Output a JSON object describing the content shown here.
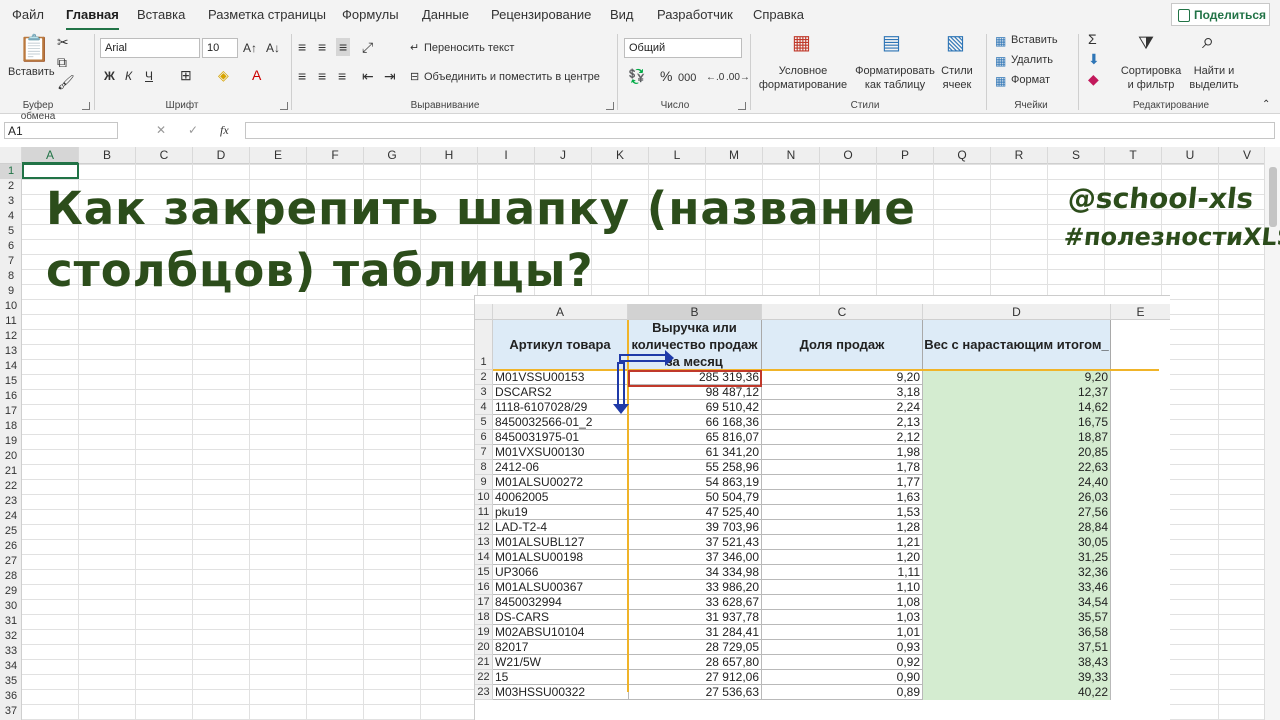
{
  "menu": {
    "tabs": [
      "Файл",
      "Главная",
      "Вставка",
      "Разметка страницы",
      "Формулы",
      "Данные",
      "Рецензирование",
      "Вид",
      "Разработчик",
      "Справка"
    ],
    "active": "Главная",
    "share": "Поделиться"
  },
  "ribbon": {
    "clipboard": {
      "paste": "Вставить",
      "label": "Буфер обмена"
    },
    "font": {
      "name": "Arial",
      "size": "10",
      "label": "Шрифт",
      "bold": "Ж",
      "italic": "К",
      "underline": "Ч"
    },
    "align": {
      "wrap": "Переносить текст",
      "merge": "Объединить и поместить в центре",
      "label": "Выравнивание"
    },
    "number": {
      "format": "Общий",
      "label": "Число"
    },
    "styles": {
      "cond1": "Условное",
      "cond2": "форматирование",
      "fmt1": "Форматировать",
      "fmt2": "как таблицу",
      "cell1": "Стили",
      "cell2": "ячеек",
      "label": "Стили"
    },
    "cells": {
      "insert": "Вставить",
      "delete": "Удалить",
      "format": "Формат",
      "label": "Ячейки"
    },
    "edit": {
      "sort1": "Сортировка",
      "sort2": "и фильтр",
      "find1": "Найти и",
      "find2": "выделить",
      "label": "Редактирование"
    }
  },
  "formula": {
    "namebox": "A1",
    "fx": "fx"
  },
  "columns": [
    "A",
    "B",
    "C",
    "D",
    "E",
    "F",
    "G",
    "H",
    "I",
    "J",
    "K",
    "L",
    "M",
    "N",
    "O",
    "P",
    "Q",
    "R",
    "S",
    "T",
    "U",
    "V"
  ],
  "rows": [
    "1",
    "2",
    "3",
    "4",
    "5",
    "6",
    "7",
    "8",
    "9",
    "10",
    "11",
    "12",
    "13",
    "14",
    "15",
    "16",
    "17",
    "18",
    "19",
    "20",
    "21",
    "22",
    "23",
    "24",
    "25",
    "26",
    "27",
    "28",
    "29",
    "30",
    "31",
    "32",
    "33",
    "34",
    "35",
    "36",
    "37"
  ],
  "overlay": {
    "line1": "Как закрепить шапку (название",
    "line2": "столбцов) таблицы?",
    "brand1": "@school-xls",
    "brand2": "#полезностиXLS"
  },
  "inset": {
    "cols": [
      "A",
      "B",
      "C",
      "D",
      "E"
    ],
    "headers": {
      "a": "Артикул товара",
      "b": "Выручка или количество продаж за месяц",
      "c": "Доля продаж",
      "d": "Вес с нарастающим итогом_"
    },
    "rows": [
      {
        "n": "2",
        "a": "M01VSSU00153",
        "b": "285 319,36",
        "c": "9,20",
        "d": "9,20"
      },
      {
        "n": "3",
        "a": "DSCARS2",
        "b": "98 487,12",
        "c": "3,18",
        "d": "12,37"
      },
      {
        "n": "4",
        "a": "1118-6107028/29",
        "b": "69 510,42",
        "c": "2,24",
        "d": "14,62"
      },
      {
        "n": "5",
        "a": "8450032566-01_2",
        "b": "66 168,36",
        "c": "2,13",
        "d": "16,75"
      },
      {
        "n": "6",
        "a": "8450031975-01",
        "b": "65 816,07",
        "c": "2,12",
        "d": "18,87"
      },
      {
        "n": "7",
        "a": "M01VXSU00130",
        "b": "61 341,20",
        "c": "1,98",
        "d": "20,85"
      },
      {
        "n": "8",
        "a": "2412-06",
        "b": "55 258,96",
        "c": "1,78",
        "d": "22,63"
      },
      {
        "n": "9",
        "a": "M01ALSU00272",
        "b": "54 863,19",
        "c": "1,77",
        "d": "24,40"
      },
      {
        "n": "10",
        "a": "40062005",
        "b": "50 504,79",
        "c": "1,63",
        "d": "26,03"
      },
      {
        "n": "11",
        "a": "pku19",
        "b": "47 525,40",
        "c": "1,53",
        "d": "27,56"
      },
      {
        "n": "12",
        "a": "LAD-T2-4",
        "b": "39 703,96",
        "c": "1,28",
        "d": "28,84"
      },
      {
        "n": "13",
        "a": "M01ALSUBL127",
        "b": "37 521,43",
        "c": "1,21",
        "d": "30,05"
      },
      {
        "n": "14",
        "a": "M01ALSU00198",
        "b": "37 346,00",
        "c": "1,20",
        "d": "31,25"
      },
      {
        "n": "15",
        "a": "UP3066",
        "b": "34 334,98",
        "c": "1,11",
        "d": "32,36"
      },
      {
        "n": "16",
        "a": "M01ALSU00367",
        "b": "33 986,20",
        "c": "1,10",
        "d": "33,46"
      },
      {
        "n": "17",
        "a": "8450032994",
        "b": "33 628,67",
        "c": "1,08",
        "d": "34,54"
      },
      {
        "n": "18",
        "a": "DS-CARS",
        "b": "31 937,78",
        "c": "1,03",
        "d": "35,57"
      },
      {
        "n": "19",
        "a": "M02ABSU10104",
        "b": "31 284,41",
        "c": "1,01",
        "d": "36,58"
      },
      {
        "n": "20",
        "a": "82017",
        "b": "28 729,05",
        "c": "0,93",
        "d": "37,51"
      },
      {
        "n": "21",
        "a": "W21/5W",
        "b": "28 657,80",
        "c": "0,92",
        "d": "38,43"
      },
      {
        "n": "22",
        "a": "15",
        "b": "27 912,06",
        "c": "0,90",
        "d": "39,33"
      },
      {
        "n": "23",
        "a": "M03HSSU00322",
        "b": "27 536,63",
        "c": "0,89",
        "d": "40,22"
      }
    ]
  }
}
